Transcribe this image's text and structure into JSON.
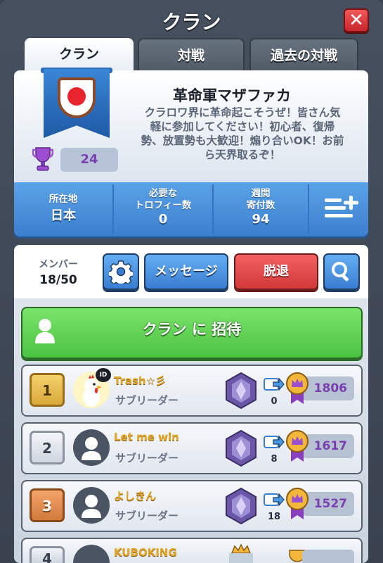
{
  "window": {
    "title": "クラン"
  },
  "tabs": [
    {
      "label": "クラン",
      "active": true
    },
    {
      "label": "対戦",
      "active": false
    },
    {
      "label": "過去の対戦",
      "active": false
    }
  ],
  "clan": {
    "name": "革命軍マザファカ",
    "description": "クラロワ界に革命起こそうぜ！皆さん気軽に参加してください！初心者、復帰勢、放置勢も大歓迎！煽り合いOK！お前ら天界取るぞ！",
    "trophies": "24",
    "badge_icon": "shield-icon"
  },
  "stats": {
    "location_label": "所在地",
    "location_value": "日本",
    "required_label_1": "必要な",
    "required_label_2": "トロフィー数",
    "required_value": "0",
    "donations_label_1": "週間",
    "donations_label_2": "寄付数",
    "donations_value": "94"
  },
  "members": {
    "label": "メンバー",
    "count": "18/50",
    "message_button": "メッセージ",
    "leave_button": "脱退",
    "invite_button": "クラン に 招待"
  },
  "member_rows": [
    {
      "rank": "1",
      "name": "Trash☆彡",
      "role": "サブリーダー",
      "donations": "0",
      "trophies": "1806",
      "rank_style": "gold",
      "has_id_badge": true,
      "id_label": "ID"
    },
    {
      "rank": "2",
      "name": "Let me win",
      "role": "サブリーダー",
      "donations": "8",
      "trophies": "1617",
      "rank_style": "silver"
    },
    {
      "rank": "3",
      "name": "よしきん",
      "role": "サブリーダー",
      "donations": "18",
      "trophies": "1527",
      "rank_style": "bronze"
    },
    {
      "rank": "4",
      "name": "KUBOKING",
      "role": "",
      "donations": "",
      "trophies": "",
      "rank_style": "silver"
    }
  ],
  "colors": {
    "accent_blue": "#3b80cf",
    "leave_red": "#d33a3a",
    "invite_green": "#4bc342",
    "trophy_purple": "#7a3fb0",
    "name_gold": "#e0a72a"
  }
}
